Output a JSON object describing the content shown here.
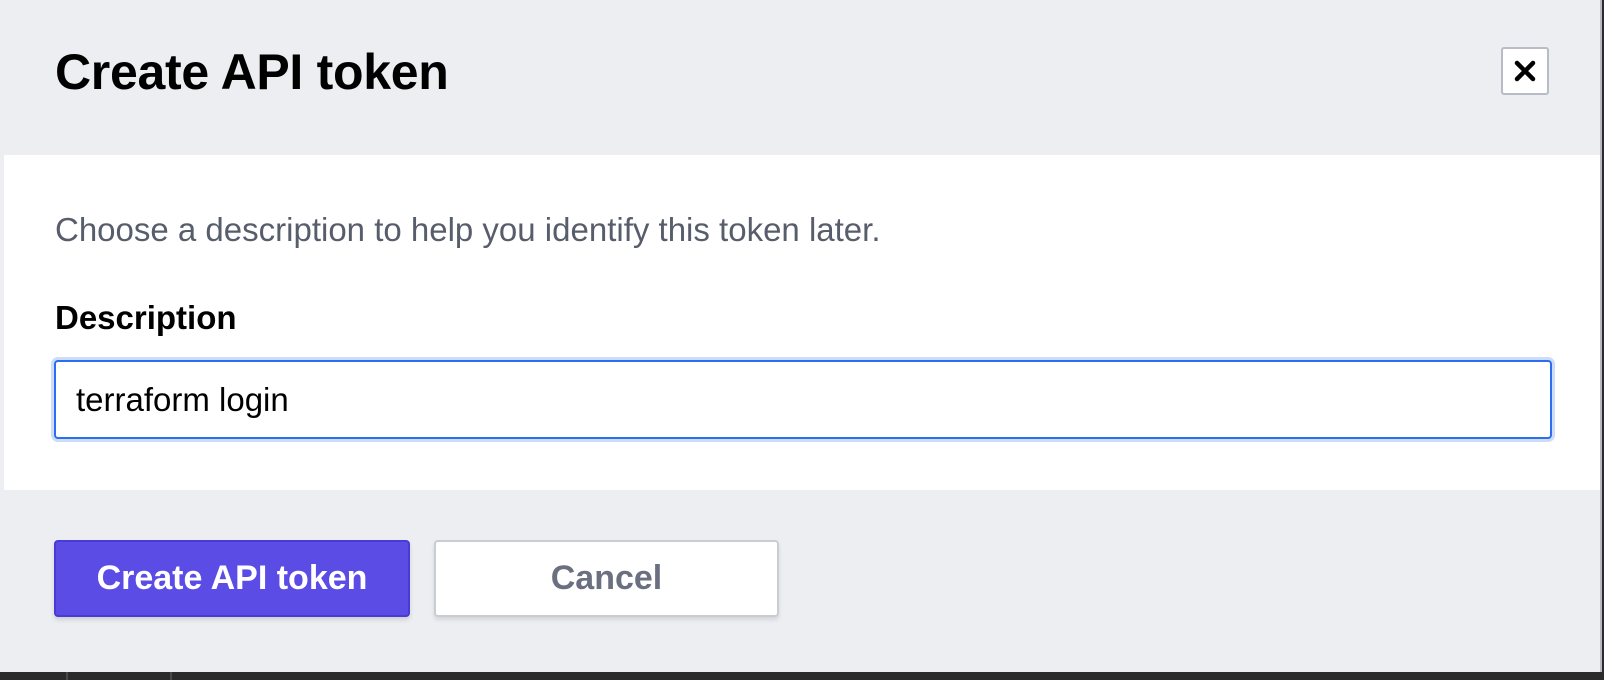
{
  "modal": {
    "title": "Create API token",
    "close_icon": "close-icon",
    "body_text": "Choose a description to help you identify this token later.",
    "field_label": "Description",
    "input_value": "terraform login",
    "primary_button_label": "Create API token",
    "cancel_button_label": "Cancel"
  },
  "colors": {
    "primary": "#5b4ce6",
    "focus_border": "#2b6ef0",
    "header_bg": "#edeef2"
  }
}
